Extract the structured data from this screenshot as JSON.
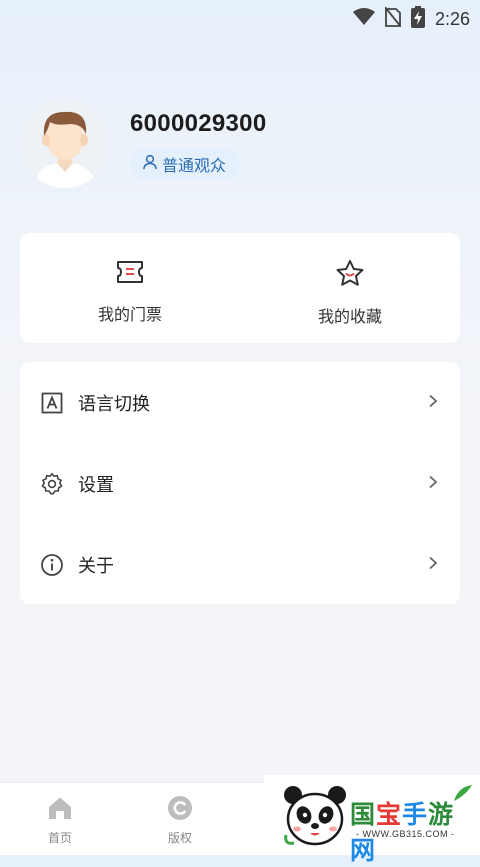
{
  "status_bar": {
    "time": "2:26"
  },
  "profile": {
    "user_id": "6000029300",
    "role_badge": "普通观众"
  },
  "quick_actions": [
    {
      "label": "我的门票",
      "icon": "ticket-icon"
    },
    {
      "label": "我的收藏",
      "icon": "star-icon"
    }
  ],
  "menu": [
    {
      "label": "语言切换",
      "icon": "language-icon"
    },
    {
      "label": "设置",
      "icon": "gear-icon"
    },
    {
      "label": "关于",
      "icon": "info-icon"
    }
  ],
  "tabs": [
    {
      "label": "首页",
      "icon": "home-icon"
    },
    {
      "label": "版权",
      "icon": "copyright-icon"
    }
  ],
  "watermark": {
    "title": "国宝手游网",
    "url": "- WWW.GB315.COM -"
  },
  "colors": {
    "accent": "#2b6cb5",
    "ticket_red": "#e24b4b",
    "badge_bg": "#e4f0fb"
  }
}
